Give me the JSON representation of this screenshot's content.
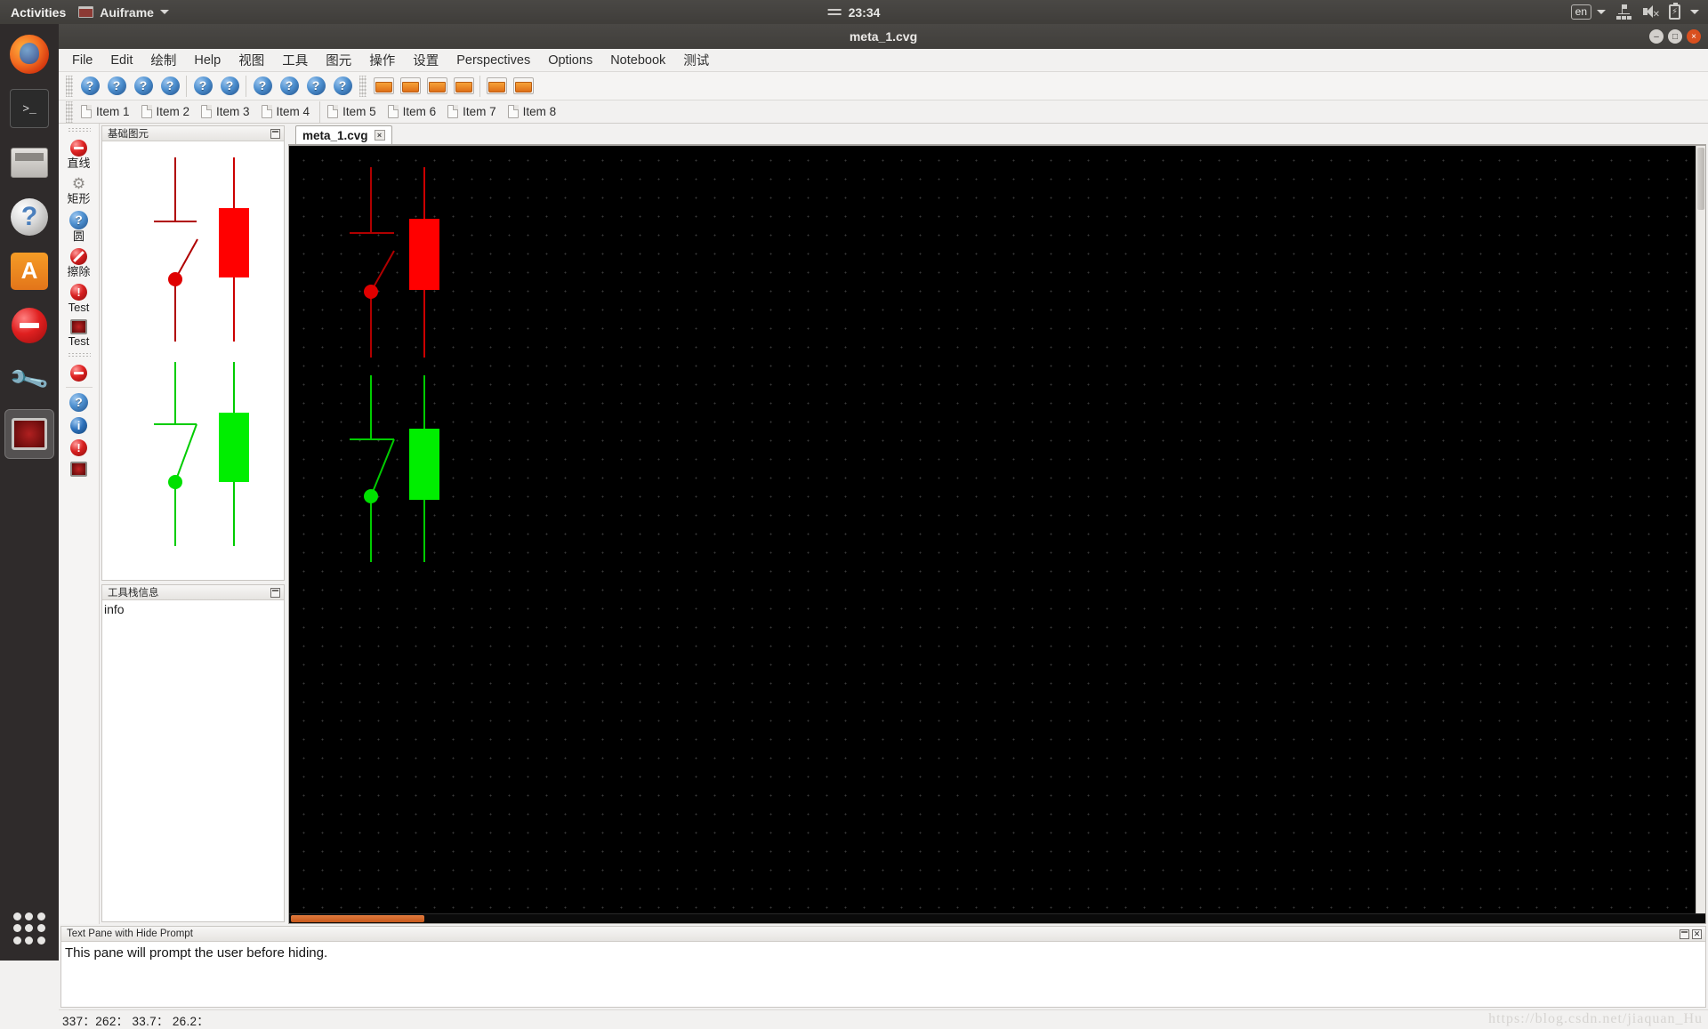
{
  "desktop": {
    "activities": "Activities",
    "app_name": "Auiframe",
    "clock": "23:34",
    "language": "en",
    "icons": {
      "network": "network-icon",
      "volume": "volume-muted-icon",
      "battery": "battery-icon"
    }
  },
  "launcher": {
    "items": [
      {
        "name": "firefox",
        "label": "Firefox"
      },
      {
        "name": "terminal",
        "label": "Terminal",
        "glyph": ">_"
      },
      {
        "name": "files",
        "label": "Files"
      },
      {
        "name": "help",
        "label": "Help",
        "glyph": "?"
      },
      {
        "name": "software",
        "label": "Ubuntu Software",
        "glyph": "A"
      },
      {
        "name": "stop",
        "label": "Stop"
      },
      {
        "name": "settings",
        "label": "System Settings"
      },
      {
        "name": "auiframe",
        "label": "Auiframe"
      }
    ],
    "show_apps": "Show Applications"
  },
  "window": {
    "title": "meta_1.cvg",
    "buttons": {
      "minimize": "–",
      "maximize": "□",
      "close": "×"
    }
  },
  "menu": {
    "items": [
      "File",
      "Edit",
      "绘制",
      "Help",
      "视图",
      "工具",
      "图元",
      "操作",
      "设置",
      "Perspectives",
      "Options",
      "Notebook",
      "测试"
    ]
  },
  "toolbar": {
    "help_groups": [
      4,
      2,
      4
    ],
    "help_glyph": "?",
    "folder_groups": [
      4,
      2
    ],
    "help_button_name": "help-button",
    "folder_button_name": "folder-button"
  },
  "items_bar": {
    "groups": [
      [
        "Item 1",
        "Item 2",
        "Item 3",
        "Item 4"
      ],
      [
        "Item 5",
        "Item 6",
        "Item 7",
        "Item 8"
      ]
    ]
  },
  "side_tools": {
    "groups": [
      [
        {
          "icon": "stop-icon",
          "label": "直线"
        },
        {
          "icon": "gears-icon",
          "label": "矩形"
        },
        {
          "icon": "help-icon",
          "label": "圆"
        },
        {
          "icon": "forbidden-icon",
          "label": "擦除"
        },
        {
          "icon": "warning-icon",
          "label": "Test"
        },
        {
          "icon": "monitor-icon",
          "label": "Test"
        }
      ],
      [
        {
          "icon": "stop-icon",
          "label": ""
        },
        {
          "icon": "help-icon",
          "label": ""
        },
        {
          "icon": "info-icon",
          "label": ""
        },
        {
          "icon": "warning-icon",
          "label": ""
        },
        {
          "icon": "monitor-icon",
          "label": ""
        }
      ]
    ]
  },
  "panels": {
    "primitives": {
      "title": "基础图元"
    },
    "tool_stack": {
      "title": "工具栈信息",
      "content": "info"
    }
  },
  "canvas": {
    "tab_label": "meta_1.cvg",
    "tab_close": "×",
    "background": "#000000",
    "grid_dot_color": "#3a3a3a",
    "shapes": [
      {
        "name": "disconnect-switch-open-red",
        "color": "#cc0000",
        "state": "open",
        "variant": "line"
      },
      {
        "name": "breaker-closed-red",
        "color": "#ff0000",
        "state": "closed",
        "variant": "block"
      },
      {
        "name": "disconnect-switch-open-green",
        "color": "#00dd00",
        "state": "open",
        "variant": "line"
      },
      {
        "name": "breaker-closed-green",
        "color": "#00ee00",
        "state": "closed",
        "variant": "block"
      }
    ]
  },
  "text_pane": {
    "title": "Text Pane with Hide Prompt",
    "content": "This pane will prompt the user before hiding."
  },
  "status_bar": {
    "text": "337：262： 33.7： 26.2："
  },
  "watermark": {
    "text": "https://blog.csdn.net/jiaquan_Hu"
  }
}
